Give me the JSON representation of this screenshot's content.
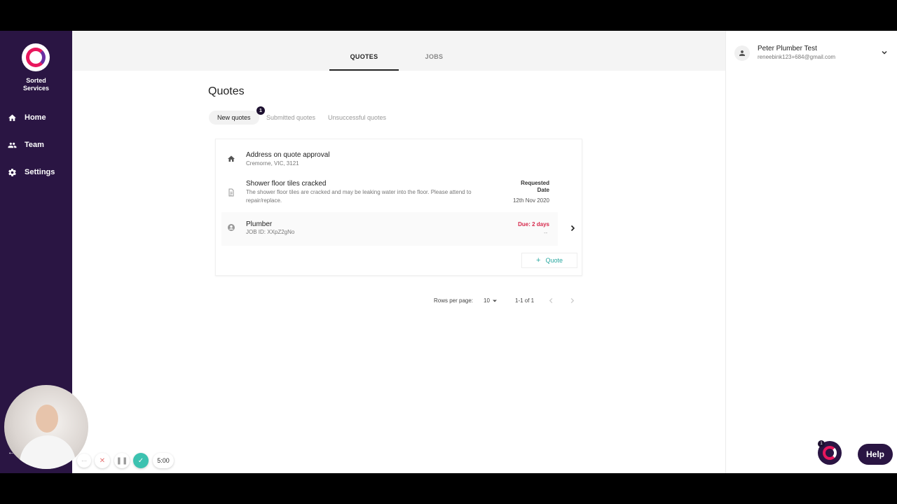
{
  "app": {
    "brand_name": "Sorted Services"
  },
  "sidebar": {
    "items": [
      {
        "label": "Home",
        "icon": "home-icon"
      },
      {
        "label": "Team",
        "icon": "team-icon"
      },
      {
        "label": "Settings",
        "icon": "gear-icon"
      }
    ]
  },
  "top_tabs": [
    {
      "label": "QUOTES",
      "active": true
    },
    {
      "label": "JOBS",
      "active": false
    }
  ],
  "user": {
    "name": "Peter Plumber Test",
    "email": "reneebink123+684@gmail.com"
  },
  "page": {
    "title": "Quotes",
    "sub_tabs": [
      {
        "label": "New quotes",
        "active": true
      },
      {
        "label": "Submitted quotes",
        "active": false
      },
      {
        "label": "Unsuccessful quotes",
        "active": false
      }
    ],
    "new_badge_count": "1"
  },
  "quote_card": {
    "address_title": "Address on quote approval",
    "address_sub": "Cremorne, VIC, 3121",
    "issue_title": "Shower floor tiles cracked",
    "issue_desc": "The shower floor tiles are cracked and may be leaking water into the floor. Please attend to repair/replace.",
    "requested_label": "Requested Date",
    "requested_date": "12th Nov 2020",
    "trade": "Plumber",
    "job_id": "JOB ID: XXpZ2gNo",
    "due": "Due: 2 days",
    "due_sub": "--",
    "quote_button": "Quote"
  },
  "pager": {
    "rows_label": "Rows per page:",
    "rows_value": "10",
    "range": "1-1 of 1"
  },
  "recorder": {
    "timer": "5:00"
  },
  "widget": {
    "badge": "1",
    "help_label": "Help"
  },
  "colors": {
    "sidebar_bg": "#2a1543",
    "accent_pink": "#e8175d",
    "due_red": "#d6284b",
    "teal": "#2aa8a0"
  }
}
